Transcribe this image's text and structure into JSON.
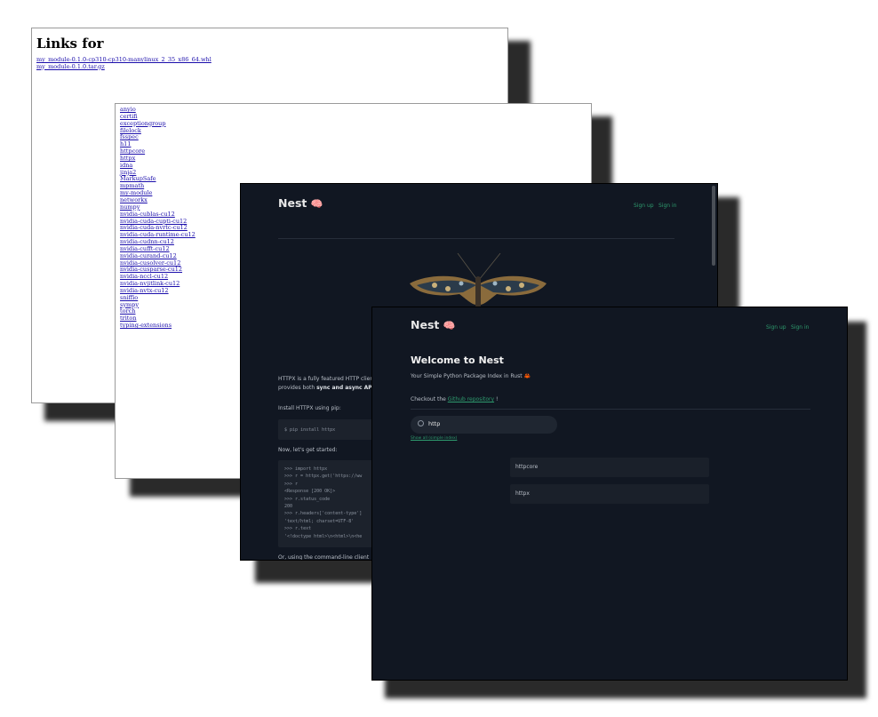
{
  "panel1": {
    "heading": "Links for",
    "links": [
      "my_module-0.1.0-cp310-cp310-manylinux_2_35_x86_64.whl",
      "my_module-0.1.0.tar.gz"
    ]
  },
  "panel2": {
    "packages": [
      "anyio",
      "certifi",
      "exceptiongroup",
      "filelock",
      "fsspec",
      "h11",
      "httpcore",
      "httpx",
      "idna",
      "jinja2",
      "MarkupSafe",
      "mpmath",
      "my-module",
      "networkx",
      "numpy",
      "nvidia-cublas-cu12",
      "nvidia-cuda-cupti-cu12",
      "nvidia-cuda-nvrtc-cu12",
      "nvidia-cuda-runtime-cu12",
      "nvidia-cudnn-cu12",
      "nvidia-cufft-cu12",
      "nvidia-curand-cu12",
      "nvidia-cusolver-cu12",
      "nvidia-cusparse-cu12",
      "nvidia-nccl-cu12",
      "nvidia-nvjitlink-cu12",
      "nvidia-nvtx-cu12",
      "sniffio",
      "sympy",
      "torch",
      "triton",
      "typing-extensions"
    ]
  },
  "panel3": {
    "brand": "Nest",
    "brand_icon": "brain-emoji",
    "nav": {
      "signup": "Sign up",
      "signin": "Sign in"
    },
    "intro_line1": "HTTPX is a fully featured HTTP client",
    "intro_line2_pre": "provides both ",
    "intro_line2_bold": "sync and async APIs",
    "intro_line2_post": ".",
    "install_label": "Install HTTPX using pip:",
    "install_cmd": "$ pip install httpx",
    "started_label": "Now, let's get started:",
    "code_lines": [
      ">>> import httpx",
      ">>> r = httpx.get('https://ww",
      ">>> r",
      "<Response [200 OK]>",
      ">>> r.status_code",
      "200",
      ">>> r.headers['content-type']",
      "'text/html; charset=UTF-8'",
      ">>> r.text",
      "'<!doctype html>\\n<html>\\n<he"
    ],
    "cli_label": "Or, using the command-line client"
  },
  "panel4": {
    "brand": "Nest",
    "brand_icon": "brain-emoji",
    "nav": {
      "signup": "Sign up",
      "signin": "Sign in"
    },
    "title": "Welcome to Nest",
    "tagline": "Your Simple Python Package Index in Rust 🦀",
    "checkout_pre": "Checkout the ",
    "checkout_link": "Github repository",
    "checkout_post": " !",
    "search_value": "http",
    "show_all": "Show all (simple index)",
    "results": [
      "httpcore",
      "httpx"
    ]
  },
  "colors": {
    "dark_bg": "#111722",
    "accent": "#2e9b6e"
  }
}
